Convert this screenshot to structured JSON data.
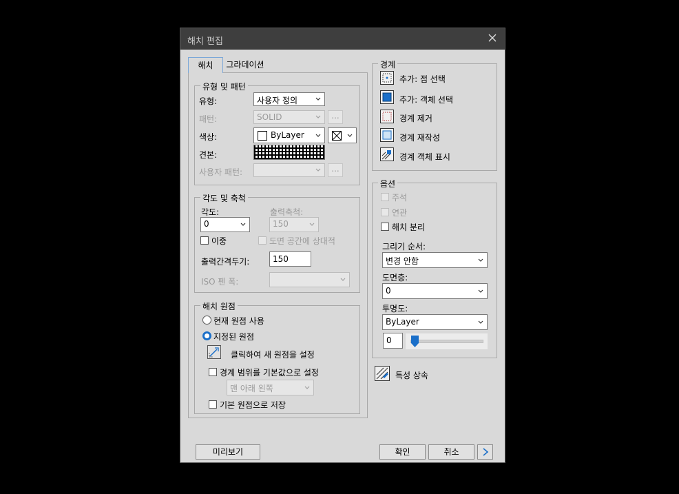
{
  "dialog": {
    "title": "해치 편집"
  },
  "tabs": [
    {
      "label": "해치"
    },
    {
      "label": "그라데이션"
    }
  ],
  "type_pattern": {
    "legend": "유형 및 패턴",
    "type_label": "유형:",
    "type_value": "사용자 정의",
    "pattern_label": "패턴:",
    "pattern_value": "SOLID",
    "color_label": "색상:",
    "color_value": "ByLayer",
    "swatch_label": "견본:",
    "custom_pattern_label": "사용자 패턴:",
    "ellipsis": "..."
  },
  "angle_scale": {
    "legend": "각도 및 축척",
    "angle_label": "각도:",
    "angle_value": "0",
    "scale_label": "출력축척:",
    "scale_value": "150",
    "double_label": "이중",
    "relative_label": "도면 공간에 상대적",
    "spacing_label": "출력간격두기:",
    "spacing_value": "150",
    "iso_label": "ISO 펜 폭:"
  },
  "origin": {
    "legend": "해치 원점",
    "current_label": "현재 원점 사용",
    "specified_label": "지정된 원점",
    "click_label": "클릭하여 새 원점을 설정",
    "boundary_default_label": "경계 범위를 기본값으로 설정",
    "position_value": "맨 아래 왼쪽",
    "store_default_label": "기본 원점으로 저장"
  },
  "boundary": {
    "legend": "경계",
    "items": [
      {
        "label": "추가: 점 선택"
      },
      {
        "label": "추가: 객체 선택"
      },
      {
        "label": "경계 제거"
      },
      {
        "label": "경계 재작성"
      },
      {
        "label": "경계 객체 표시"
      }
    ]
  },
  "options": {
    "legend": "옵션",
    "annotative_label": "주석",
    "associative_label": "연관",
    "separate_label": "해치 분리",
    "draw_order_label": "그리기 순서:",
    "draw_order_value": "변경 안함",
    "layer_label": "도면층:",
    "layer_value": "0",
    "transparency_label": "투명도:",
    "transparency_value": "ByLayer",
    "transparency_amount": "0"
  },
  "inherit": {
    "label": "특성 상속"
  },
  "footer": {
    "preview": "미리보기",
    "ok": "확인",
    "cancel": "취소"
  },
  "colors": {
    "accent": "#1a6fc9",
    "title_bg": "#3e3e3e",
    "dialog_bg": "#d9d9d9"
  }
}
